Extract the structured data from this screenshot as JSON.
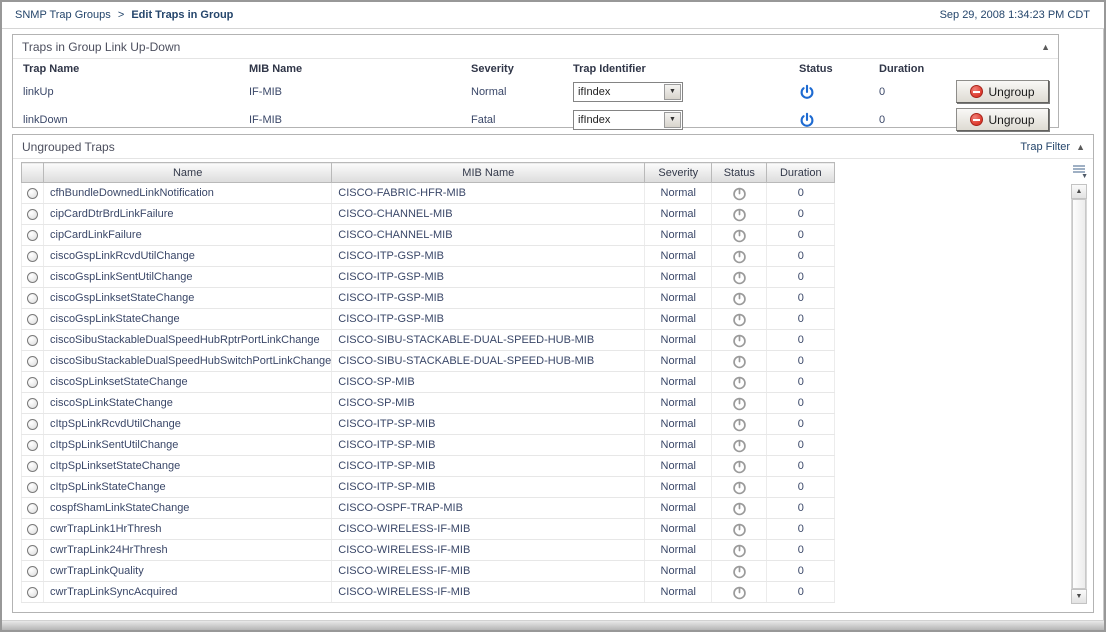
{
  "header": {
    "breadcrumb_root": "SNMP Trap Groups",
    "breadcrumb_sep": ">",
    "breadcrumb_current": "Edit Traps in Group",
    "timestamp": "Sep 29, 2008 1:34:23 PM CDT"
  },
  "group_panel": {
    "title": "Traps in Group Link Up-Down",
    "columns": {
      "trap_name": "Trap Name",
      "mib_name": "MIB Name",
      "severity": "Severity",
      "trap_identifier": "Trap Identifier",
      "status": "Status",
      "duration": "Duration"
    },
    "ungroup_label": "Ungroup",
    "rows": [
      {
        "trap_name": "linkUp",
        "mib_name": "IF-MIB",
        "severity": "Normal",
        "trap_identifier": "ifIndex",
        "status": "on",
        "duration": "0"
      },
      {
        "trap_name": "linkDown",
        "mib_name": "IF-MIB",
        "severity": "Fatal",
        "trap_identifier": "ifIndex",
        "status": "on",
        "duration": "0"
      }
    ]
  },
  "ungrouped_panel": {
    "title": "Ungrouped Traps",
    "filter_label": "Trap Filter",
    "columns": {
      "name": "Name",
      "mib_name": "MIB Name",
      "severity": "Severity",
      "status": "Status",
      "duration": "Duration"
    },
    "rows": [
      {
        "name": "cfhBundleDownedLinkNotification",
        "mib_name": "CISCO-FABRIC-HFR-MIB",
        "severity": "Normal",
        "status": "off",
        "duration": "0"
      },
      {
        "name": "cipCardDtrBrdLinkFailure",
        "mib_name": "CISCO-CHANNEL-MIB",
        "severity": "Normal",
        "status": "off",
        "duration": "0"
      },
      {
        "name": "cipCardLinkFailure",
        "mib_name": "CISCO-CHANNEL-MIB",
        "severity": "Normal",
        "status": "off",
        "duration": "0"
      },
      {
        "name": "ciscoGspLinkRcvdUtilChange",
        "mib_name": "CISCO-ITP-GSP-MIB",
        "severity": "Normal",
        "status": "off",
        "duration": "0"
      },
      {
        "name": "ciscoGspLinkSentUtilChange",
        "mib_name": "CISCO-ITP-GSP-MIB",
        "severity": "Normal",
        "status": "off",
        "duration": "0"
      },
      {
        "name": "ciscoGspLinksetStateChange",
        "mib_name": "CISCO-ITP-GSP-MIB",
        "severity": "Normal",
        "status": "off",
        "duration": "0"
      },
      {
        "name": "ciscoGspLinkStateChange",
        "mib_name": "CISCO-ITP-GSP-MIB",
        "severity": "Normal",
        "status": "off",
        "duration": "0"
      },
      {
        "name": "ciscoSibuStackableDualSpeedHubRptrPortLinkChange",
        "mib_name": "CISCO-SIBU-STACKABLE-DUAL-SPEED-HUB-MIB",
        "severity": "Normal",
        "status": "off",
        "duration": "0"
      },
      {
        "name": "ciscoSibuStackableDualSpeedHubSwitchPortLinkChange",
        "mib_name": "CISCO-SIBU-STACKABLE-DUAL-SPEED-HUB-MIB",
        "severity": "Normal",
        "status": "off",
        "duration": "0"
      },
      {
        "name": "ciscoSpLinksetStateChange",
        "mib_name": "CISCO-SP-MIB",
        "severity": "Normal",
        "status": "off",
        "duration": "0"
      },
      {
        "name": "ciscoSpLinkStateChange",
        "mib_name": "CISCO-SP-MIB",
        "severity": "Normal",
        "status": "off",
        "duration": "0"
      },
      {
        "name": "cItpSpLinkRcvdUtilChange",
        "mib_name": "CISCO-ITP-SP-MIB",
        "severity": "Normal",
        "status": "off",
        "duration": "0"
      },
      {
        "name": "cItpSpLinkSentUtilChange",
        "mib_name": "CISCO-ITP-SP-MIB",
        "severity": "Normal",
        "status": "off",
        "duration": "0"
      },
      {
        "name": "cItpSpLinksetStateChange",
        "mib_name": "CISCO-ITP-SP-MIB",
        "severity": "Normal",
        "status": "off",
        "duration": "0"
      },
      {
        "name": "cItpSpLinkStateChange",
        "mib_name": "CISCO-ITP-SP-MIB",
        "severity": "Normal",
        "status": "off",
        "duration": "0"
      },
      {
        "name": "cospfShamLinkStateChange",
        "mib_name": "CISCO-OSPF-TRAP-MIB",
        "severity": "Normal",
        "status": "off",
        "duration": "0"
      },
      {
        "name": "cwrTrapLink1HrThresh",
        "mib_name": "CISCO-WIRELESS-IF-MIB",
        "severity": "Normal",
        "status": "off",
        "duration": "0"
      },
      {
        "name": "cwrTrapLink24HrThresh",
        "mib_name": "CISCO-WIRELESS-IF-MIB",
        "severity": "Normal",
        "status": "off",
        "duration": "0"
      },
      {
        "name": "cwrTrapLinkQuality",
        "mib_name": "CISCO-WIRELESS-IF-MIB",
        "severity": "Normal",
        "status": "off",
        "duration": "0"
      },
      {
        "name": "cwrTrapLinkSyncAcquired",
        "mib_name": "CISCO-WIRELESS-IF-MIB",
        "severity": "Normal",
        "status": "off",
        "duration": "0"
      }
    ]
  },
  "colors": {
    "status_on": "#1d6ad1",
    "status_off": "#9a9a9a",
    "ungroup_red": "#dd3a2e",
    "text_navy": "#3a4768",
    "breadcrumb": "#24456b"
  }
}
